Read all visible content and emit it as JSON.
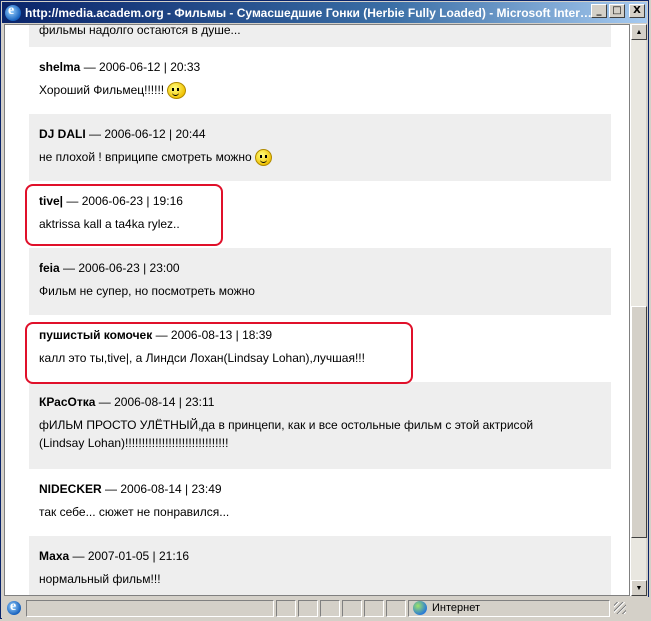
{
  "window": {
    "title": "http://media.academ.org - Фильмы - Сумасшедшие Гонки (Herbie Fully Loaded) - Microsoft Intern...",
    "controls": {
      "minimize": "_",
      "maximize": "□",
      "close": "X"
    }
  },
  "comments": [
    {
      "author": "",
      "date": "",
      "text": "фильмы надолго остаются в душе..."
    },
    {
      "author": "shelma",
      "date": " — 2006-06-12 | 20:33",
      "text": "Хороший Фильмец!!!!!!",
      "emoticon": "winking-smiley-icon"
    },
    {
      "author": "DJ DALI",
      "date": " — 2006-06-12 | 20:44",
      "text": "не плохой ! вприципе смотреть можно",
      "emoticon": "smiley-icon"
    },
    {
      "author": "tive|",
      "date": " — 2006-06-23 | 19:16",
      "text": "aktrissa kall a ta4ka rylez..",
      "highlighted": true
    },
    {
      "author": "feia",
      "date": " — 2006-06-23 | 23:00",
      "text": "Фильм не супер, но посмотреть можно"
    },
    {
      "author": "пушистый комочек",
      "date": " — 2006-08-13 | 18:39",
      "text": "калл это ты,tive|, а Линдси Лохан(Lindsay Lohan),лучшая!!!",
      "highlighted": true
    },
    {
      "author": "КРасОтка",
      "date": " — 2006-08-14 | 23:11",
      "text": "фИЛЬМ ПРОСТО УЛЁТНЫЙ,да в принцепи, как и все остольные фильм с этой актрисой (Lindsay Lohan)!!!!!!!!!!!!!!!!!!!!!!!!!!!!!!!"
    },
    {
      "author": "NIDECKER",
      "date": " — 2006-08-14 | 23:49",
      "text": "так себе... сюжет не понравился..."
    },
    {
      "author": "Маха",
      "date": " — 2007-01-05 | 21:16",
      "text": "нормальный фильм!!!"
    }
  ],
  "statusbar": {
    "zone": "Интернет"
  },
  "colors": {
    "highlight": "#e0102a",
    "row_alt": "#eeeeee",
    "title_start": "#0a246a",
    "title_end": "#a6caf0"
  }
}
